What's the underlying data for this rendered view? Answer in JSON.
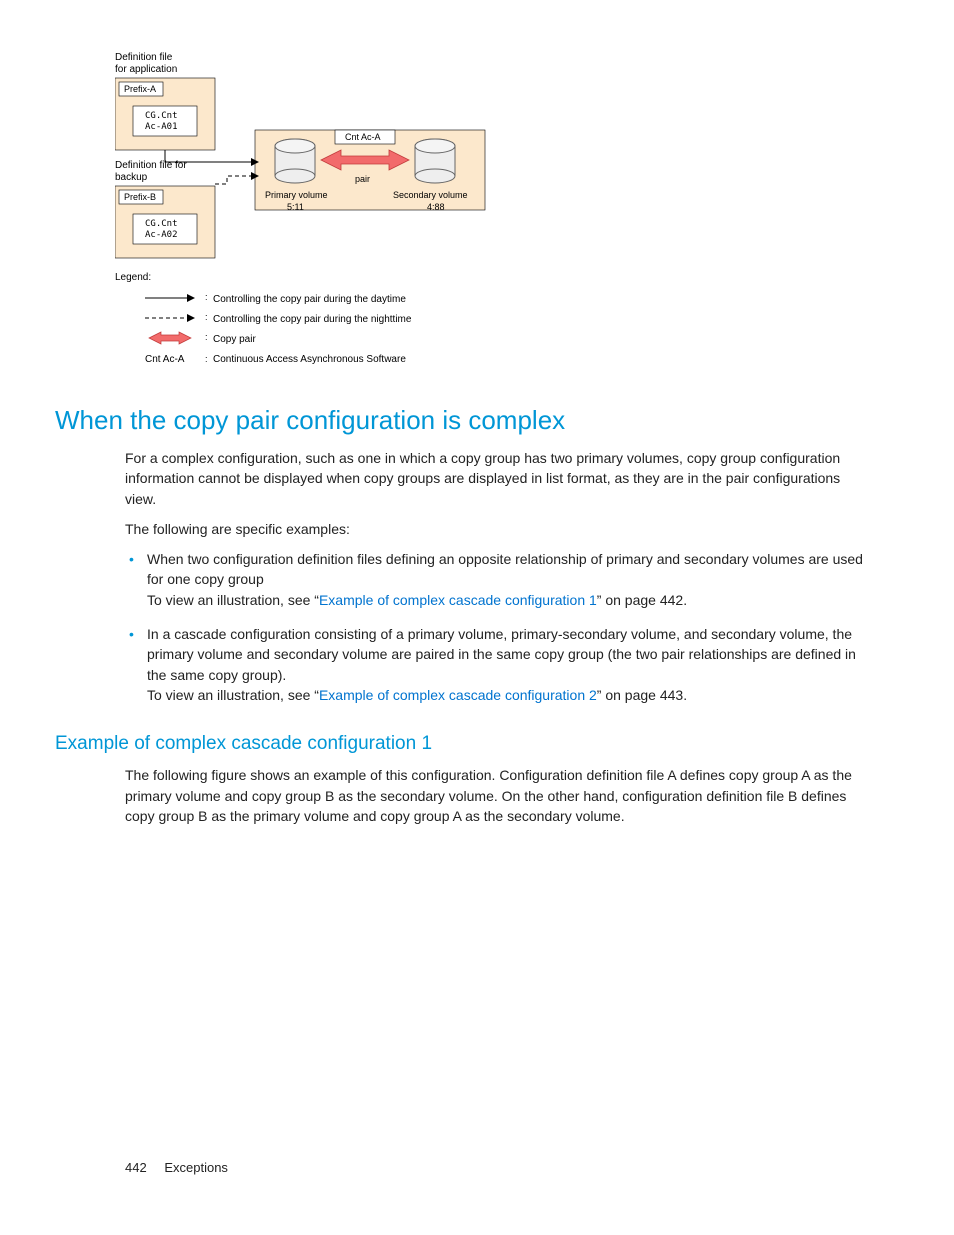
{
  "diagram": {
    "def_app_label": "Definition file\nfor application",
    "prefix_a": "Prefix-A",
    "cg_a01_line1": "CG.Cnt",
    "cg_a01_line2": "Ac-A01",
    "def_backup_label": "Definition file for\nbackup",
    "prefix_b": "Prefix-B",
    "cg_a02_line1": "CG.Cnt",
    "cg_a02_line2": "Ac-A02",
    "cnt_ac_a": "Cnt Ac-A",
    "pair_label": "pair",
    "primary_vol": "Primary volume",
    "primary_id": "5:11",
    "secondary_vol": "Secondary volume",
    "secondary_id": "4:88",
    "legend_title": "Legend:",
    "legend_day": "Controlling the copy pair during the daytime",
    "legend_night": "Controlling the copy pair during the nighttime",
    "legend_copypair": "Copy pair",
    "legend_cnt_label": "Cnt Ac-A",
    "legend_cnt_desc": "Continuous Access Asynchronous Software"
  },
  "section_title": "When the copy pair configuration is complex",
  "para1": "For a complex configuration, such as one in which a copy group has two primary volumes, copy group configuration information cannot be displayed when copy groups are displayed in list format, as they are in the pair configurations view.",
  "para2": "The following are specific examples:",
  "bullets": [
    {
      "text": "When two configuration definition files defining an opposite relationship of primary and secondary volumes are used for one copy group",
      "see_prefix": "To view an illustration, see “",
      "link": "Example of complex cascade configuration 1",
      "see_suffix": "” on page 442."
    },
    {
      "text": "In a cascade configuration consisting of a primary volume, primary-secondary volume, and secondary volume, the primary volume and secondary volume are paired in the same copy group (the two pair relationships are defined in the same copy group).",
      "see_prefix": "To view an illustration, see “",
      "link": "Example of complex cascade configuration 2",
      "see_suffix": "” on page 443."
    }
  ],
  "subsection_title": "Example of complex cascade configuration 1",
  "para3": "The following figure shows an example of this configuration. Configuration definition file A defines copy group A as the primary volume and copy group B as the secondary volume. On the other hand, configuration definition file B defines copy group B as the primary volume and copy group A as the secondary volume.",
  "footer": {
    "page": "442",
    "section": "Exceptions"
  }
}
